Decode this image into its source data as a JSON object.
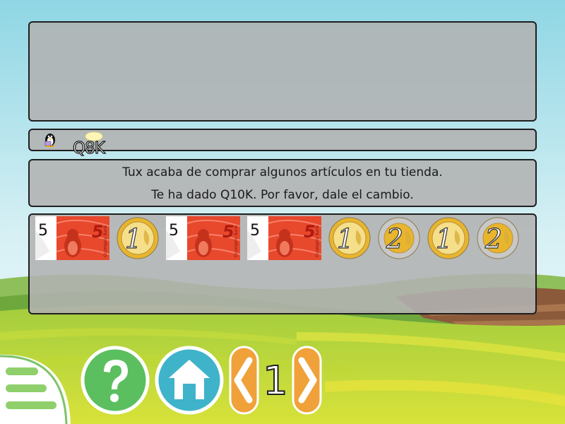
{
  "game": {
    "instruction_line1": "Tux acaba de comprar algunos artículos en tu tienda.",
    "instruction_line2": "Te ha dado Q10K. Por favor, dale el cambio.",
    "price_label": "Q8K",
    "level": "1"
  },
  "money_items": [
    {
      "kind": "bill",
      "value": "5"
    },
    {
      "kind": "coin",
      "value": "1"
    },
    {
      "kind": "bill",
      "value": "5"
    },
    {
      "kind": "bill",
      "value": "5"
    },
    {
      "kind": "coin",
      "value": "1"
    },
    {
      "kind": "coin",
      "value": "2"
    },
    {
      "kind": "coin",
      "value": "1"
    },
    {
      "kind": "coin",
      "value": "2"
    }
  ],
  "bill_text": {
    "corner": "5",
    "bank": "Gcompris Bank"
  },
  "controls": {
    "menu_icon": "menu-icon",
    "help_icon": "help-icon",
    "home_icon": "home-icon",
    "prev_icon": "previous-icon",
    "next_icon": "next-icon"
  },
  "colors": {
    "sky": "#9fdbe6",
    "field_green": "#9ccc3c",
    "help_green": "#5bbf60",
    "home_blue": "#3fb3c9",
    "arrow_orange": "#f0a13a",
    "bill_red": "#e8482c",
    "coin_gold": "#e9b52e",
    "coin_silver": "#c8c8c8"
  }
}
